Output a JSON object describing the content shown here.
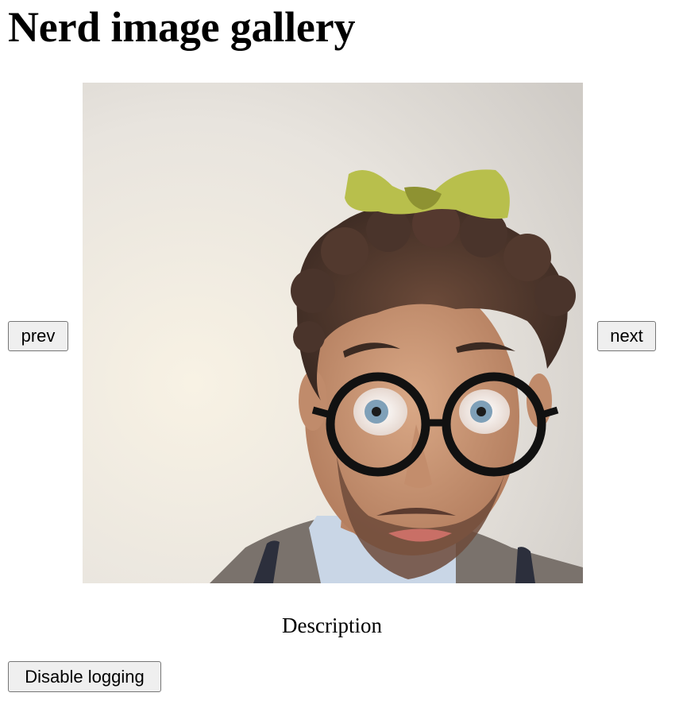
{
  "page": {
    "title": "Nerd image gallery"
  },
  "gallery": {
    "prev_label": "prev",
    "next_label": "next",
    "description": "Description"
  },
  "controls": {
    "logging_label": "Disable logging"
  }
}
